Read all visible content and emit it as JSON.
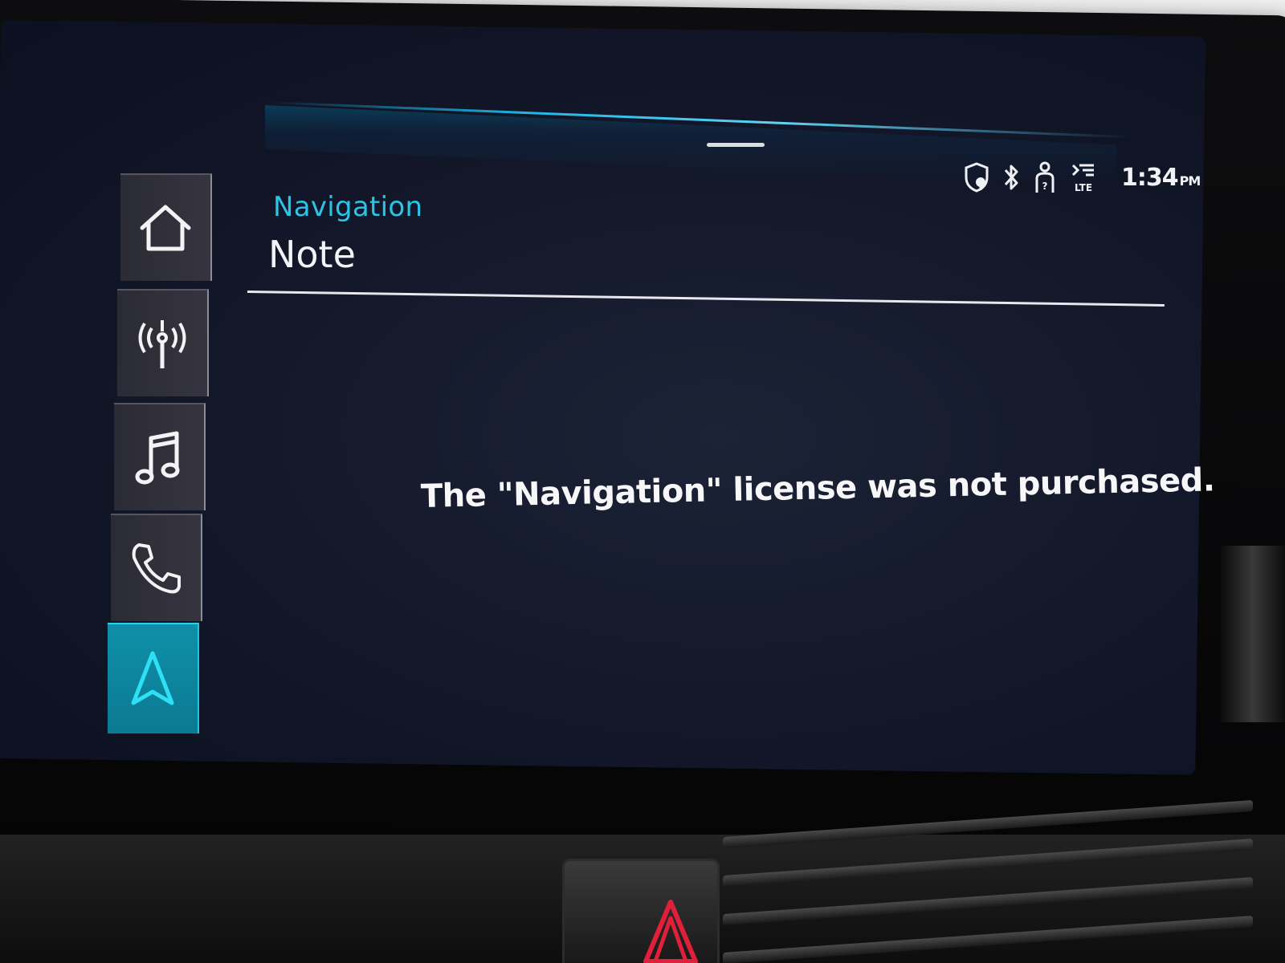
{
  "header": {
    "breadcrumb": "Navigation",
    "title": "Note"
  },
  "status_bar": {
    "time": "1:34",
    "ampm": "PM",
    "icons": [
      "privacy-shield-icon",
      "bluetooth-icon",
      "driver-profile-icon",
      "lte-signal-icon"
    ]
  },
  "sidebar": {
    "items": [
      {
        "name": "home",
        "icon": "home-icon",
        "active": false
      },
      {
        "name": "radio",
        "icon": "radio-antenna-icon",
        "active": false
      },
      {
        "name": "media",
        "icon": "music-note-icon",
        "active": false
      },
      {
        "name": "phone",
        "icon": "phone-icon",
        "active": false
      },
      {
        "name": "navigation",
        "icon": "navigation-arrow-icon",
        "active": true
      }
    ]
  },
  "message": {
    "text": "The \"Navigation\" license was not purchased."
  },
  "colors": {
    "accent": "#2cc4e6",
    "active_tab": "#0f90a8",
    "screen_bg": "#13182a",
    "hazard": "#e0203a"
  }
}
